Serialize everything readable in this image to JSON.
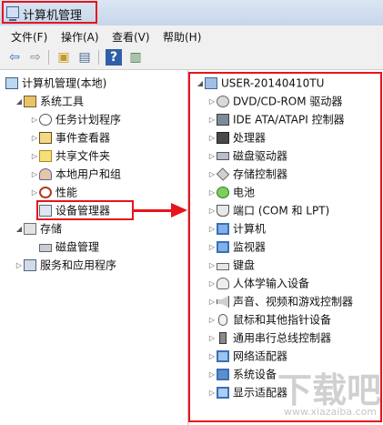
{
  "window": {
    "title": "计算机管理"
  },
  "menu": [
    {
      "label": "文件(F)"
    },
    {
      "label": "操作(A)"
    },
    {
      "label": "查看(V)"
    },
    {
      "label": "帮助(H)"
    }
  ],
  "toolbar": [
    {
      "icon": "back-arrow-icon",
      "glyph": "⇦"
    },
    {
      "icon": "forward-arrow-icon",
      "glyph": "⇨"
    },
    {
      "icon": "up-folder-icon",
      "glyph": "▣"
    },
    {
      "icon": "show-hide-tree-icon",
      "glyph": "▤"
    },
    {
      "icon": "help-icon",
      "glyph": "?"
    },
    {
      "icon": "properties-icon",
      "glyph": "▥"
    }
  ],
  "tree": {
    "root": {
      "label": "计算机管理(本地)"
    },
    "items": [
      {
        "label": "系统工具"
      },
      {
        "label": "任务计划程序"
      },
      {
        "label": "事件查看器"
      },
      {
        "label": "共享文件夹"
      },
      {
        "label": "本地用户和组"
      },
      {
        "label": "性能"
      },
      {
        "label": "设备管理器"
      },
      {
        "label": "存储"
      },
      {
        "label": "磁盘管理"
      },
      {
        "label": "服务和应用程序"
      }
    ]
  },
  "devices": {
    "computer_name": "USER-20140410TU",
    "categories": [
      {
        "label": "DVD/CD-ROM 驱动器"
      },
      {
        "label": "IDE ATA/ATAPI 控制器"
      },
      {
        "label": "处理器"
      },
      {
        "label": "磁盘驱动器"
      },
      {
        "label": "存储控制器"
      },
      {
        "label": "电池"
      },
      {
        "label": "端口 (COM 和 LPT)"
      },
      {
        "label": "计算机"
      },
      {
        "label": "监视器"
      },
      {
        "label": "键盘"
      },
      {
        "label": "人体学输入设备"
      },
      {
        "label": "声音、视频和游戏控制器"
      },
      {
        "label": "鼠标和其他指针设备"
      },
      {
        "label": "通用串行总线控制器"
      },
      {
        "label": "网络适配器"
      },
      {
        "label": "系统设备"
      },
      {
        "label": "显示适配器"
      }
    ]
  },
  "watermark": {
    "main": "下载吧",
    "url": "www.xiazaiba.com"
  },
  "colors": {
    "highlight_red": "#e8141b",
    "title_bar": "#c6d6ea"
  }
}
